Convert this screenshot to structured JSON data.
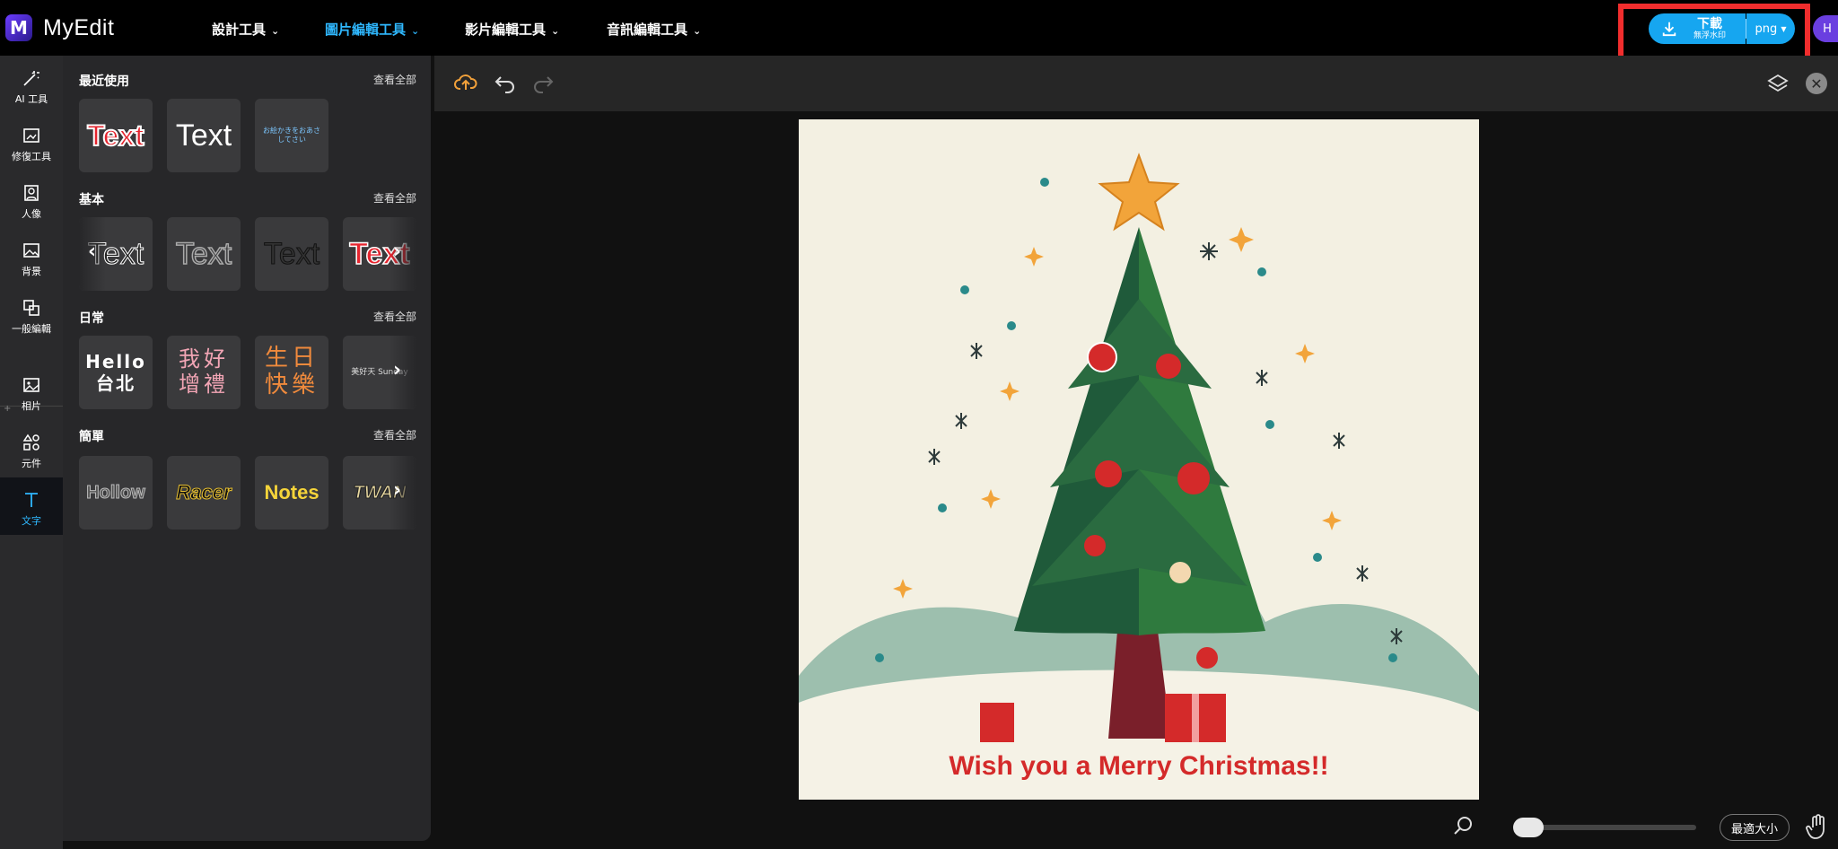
{
  "app": {
    "name": "MyEdit",
    "logo_letter": "M"
  },
  "nav": [
    {
      "label": "設計工具",
      "active": false
    },
    {
      "label": "圖片編輯工具",
      "active": true
    },
    {
      "label": "影片編輯工具",
      "active": false
    },
    {
      "label": "音訊編輯工具",
      "active": false
    }
  ],
  "download": {
    "label": "下載",
    "sublabel": "無浮水印",
    "format": "png"
  },
  "user": {
    "avatar_letter": "H"
  },
  "rail": [
    {
      "label": "AI 工具",
      "icon": "magic-wand-icon"
    },
    {
      "label": "修復工具",
      "icon": "repair-icon"
    },
    {
      "label": "人像",
      "icon": "portrait-icon"
    },
    {
      "label": "背景",
      "icon": "background-icon"
    },
    {
      "label": "一般編輯",
      "icon": "crop-icon"
    },
    {
      "label": "相片",
      "icon": "photo-icon"
    },
    {
      "label": "元件",
      "icon": "shapes-icon"
    },
    {
      "label": "文字",
      "icon": "text-icon",
      "active": true
    }
  ],
  "panel": {
    "see_all": "查看全部",
    "sections": [
      {
        "title": "最近使用",
        "tiles": [
          "Text",
          "Text",
          "お絵かきをおあさしてさい"
        ]
      },
      {
        "title": "基本",
        "tiles": [
          "Text",
          "Text",
          "Text",
          "Text"
        ]
      },
      {
        "title": "日常",
        "tiles": [
          "Hello 台北",
          "我好 增禮",
          "生日 快樂",
          "美好天 Sunday"
        ]
      },
      {
        "title": "簡單",
        "tiles": [
          "Hollow",
          "Racer",
          "Notes",
          "TWAN"
        ]
      }
    ]
  },
  "canvas": {
    "greeting": "Wish you a Merry Christmas!!"
  },
  "bottom": {
    "fit_label": "最適大小"
  },
  "colors": {
    "accent": "#16a6f0",
    "highlight": "#f12d2d",
    "active_tab": "#2fb8ff"
  }
}
